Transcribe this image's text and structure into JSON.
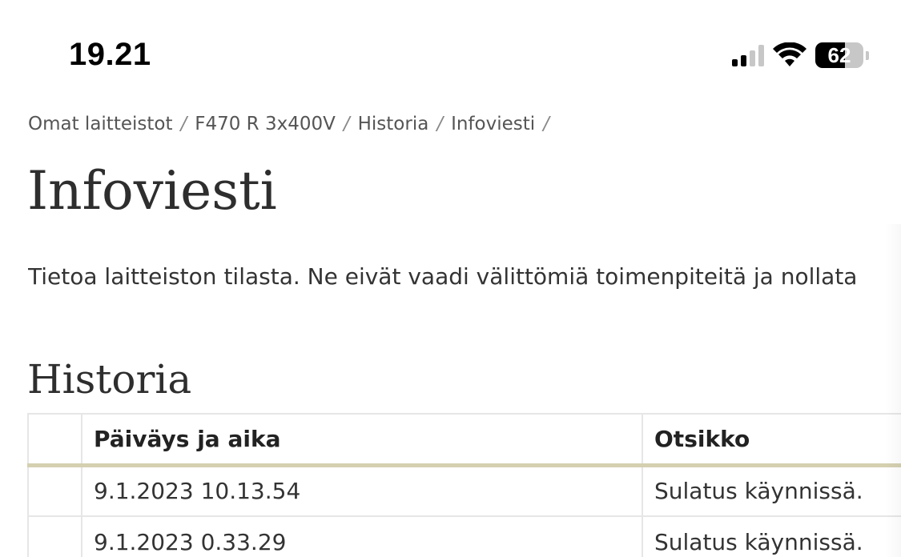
{
  "status_bar": {
    "time": "19.21",
    "signal_icon": "cellular-signal-icon",
    "wifi_icon": "wifi-icon",
    "battery_level": "62",
    "battery_fraction": 0.62
  },
  "breadcrumb": [
    {
      "label": "Omat laitteistot"
    },
    {
      "label": "F470 R 3x400V"
    },
    {
      "label": "Historia"
    },
    {
      "label": "Infoviesti"
    }
  ],
  "breadcrumb_separator": "/",
  "page": {
    "title": "Infoviesti",
    "description": "Tietoa laitteiston tilasta. Ne eivät vaadi välittömiä toimenpiteitä ja nollata"
  },
  "history": {
    "title": "Historia",
    "columns": [
      "",
      "Päiväys ja aika",
      "Otsikko"
    ],
    "rows": [
      {
        "date": "9.1.2023 10.13.54",
        "title": "Sulatus käynnissä."
      },
      {
        "date": "9.1.2023 0.33.29",
        "title": "Sulatus käynnissä."
      }
    ]
  },
  "colors": {
    "header_underline": "#d4d0b0",
    "border": "#e6e6e6",
    "text": "#333333"
  }
}
